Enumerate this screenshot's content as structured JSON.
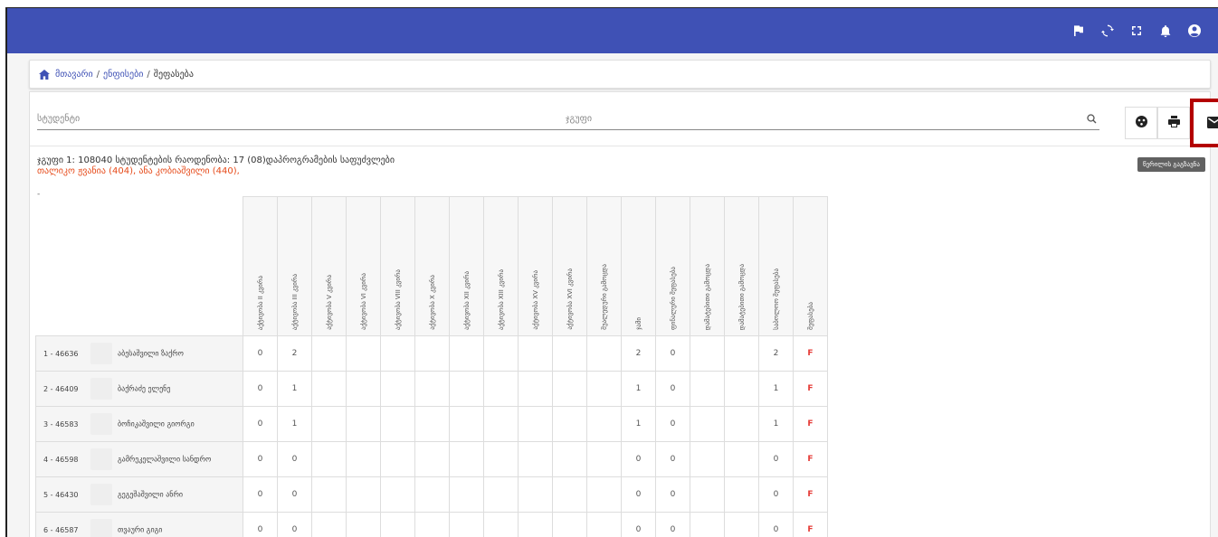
{
  "breadcrumb": {
    "home": "მთავარი",
    "courses": "ენფისები",
    "current": "შეფასება"
  },
  "filters": {
    "student_placeholder": "სტუდენტი",
    "group_placeholder": "ჯგუფი"
  },
  "tooltip": "წერილის გაგზავნა",
  "info": {
    "summary": "ჯგუფი 1: 108040 სტუდენტების რაოდენობა: 17 (08)დაპროგრამების საფუძვლები",
    "lecturers": "თალიკო ჟვანია (404), ანა კობიაშვილი (440),"
  },
  "dash": "-",
  "columns": [
    "აქტივობა II კვირა",
    "აქტივობა III კვირა",
    "აქტივობა V კვირა",
    "აქტივობა VI კვირა",
    "აქტივობა VIII კვირა",
    "აქტივობა X კვირა",
    "აქტივობა XII კვირა",
    "აქტივობა XIII კვირა",
    "აქტივობა XV კვირა",
    "აქტივობა XVI კვირა",
    "შუალედური გამოცდა",
    "ჯამი",
    "ფინალური შეფასება",
    "დამატებითი გამოცდა",
    "დამატებითი გამოცდა",
    "საბოლოო შეფასება",
    "შეფასება"
  ],
  "rows": [
    {
      "id": "1 - 46636",
      "name": "აბესაშვილი ზაქრო",
      "cells": [
        "0",
        "2",
        "",
        "",
        "",
        "",
        "",
        "",
        "",
        "",
        "",
        "2",
        "0",
        "",
        "",
        "2",
        "F"
      ]
    },
    {
      "id": "2 - 46409",
      "name": "ბაქრაძე ელენე",
      "cells": [
        "0",
        "1",
        "",
        "",
        "",
        "",
        "",
        "",
        "",
        "",
        "",
        "1",
        "0",
        "",
        "",
        "1",
        "F"
      ]
    },
    {
      "id": "3 - 46583",
      "name": "ბოჩიკაშვილი გიორგი",
      "cells": [
        "0",
        "1",
        "",
        "",
        "",
        "",
        "",
        "",
        "",
        "",
        "",
        "1",
        "0",
        "",
        "",
        "1",
        "F"
      ]
    },
    {
      "id": "4 - 46598",
      "name": "გამრეკელაშვილი სანდრო",
      "cells": [
        "0",
        "0",
        "",
        "",
        "",
        "",
        "",
        "",
        "",
        "",
        "",
        "0",
        "0",
        "",
        "",
        "0",
        "F"
      ]
    },
    {
      "id": "5 - 46430",
      "name": "გეგეშაშვილი ანრი",
      "cells": [
        "0",
        "0",
        "",
        "",
        "",
        "",
        "",
        "",
        "",
        "",
        "",
        "0",
        "0",
        "",
        "",
        "0",
        "F"
      ]
    },
    {
      "id": "6 - 46587",
      "name": "თვაური გიგი",
      "cells": [
        "0",
        "0",
        "",
        "",
        "",
        "",
        "",
        "",
        "",
        "",
        "",
        "0",
        "0",
        "",
        "",
        "0",
        "F"
      ]
    }
  ],
  "icons": [
    "flag-icon",
    "sync-icon",
    "fullscreen-icon",
    "bell-icon",
    "account-icon",
    "home-icon",
    "search-icon",
    "palette-icon",
    "print-icon",
    "mail-icon"
  ],
  "colors": {
    "topbar": "#3f51b5",
    "highlight": "#b30000",
    "lecturers": "#e64a19",
    "grade": "#e53935"
  }
}
